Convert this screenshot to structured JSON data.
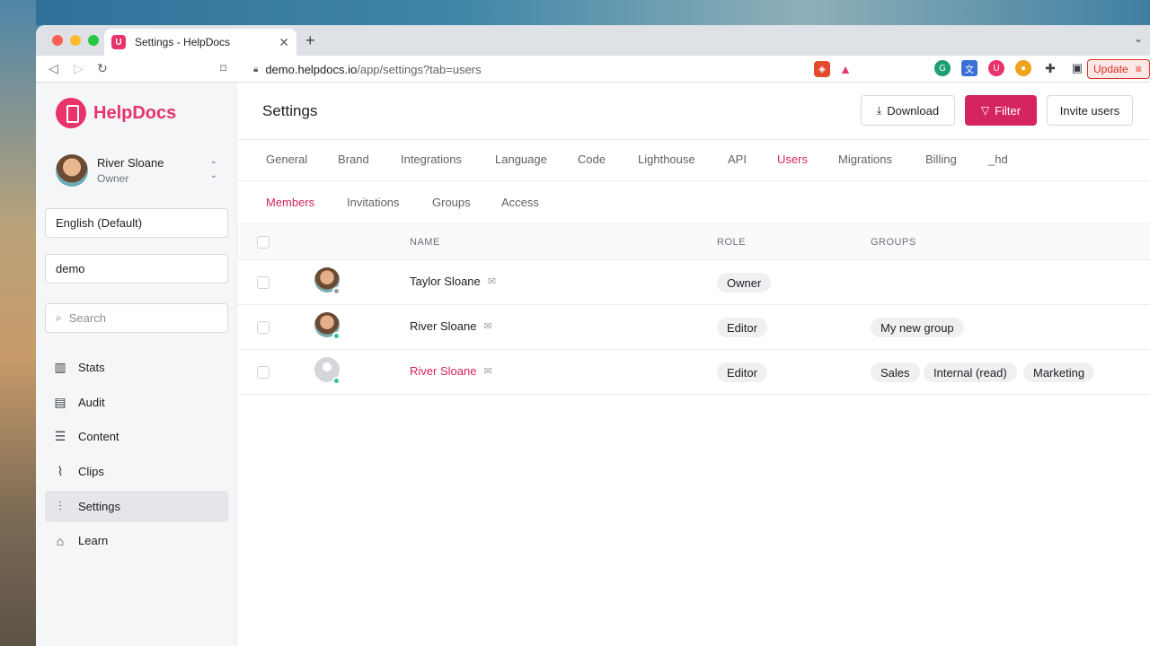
{
  "browser": {
    "tab_title": "Settings - HelpDocs",
    "url_host": "demo.helpdocs.io",
    "url_path": "/app/settings?tab=users",
    "update_label": "Update",
    "favicon_glyph": "U"
  },
  "brand": {
    "name": "HelpDocs",
    "accent": "#e8336b"
  },
  "sidebar": {
    "user_name": "River Sloane",
    "user_role": "Owner",
    "language_value": "English (Default)",
    "workspace_value": "demo",
    "search_placeholder": "Search",
    "items": [
      {
        "label": "Stats",
        "icon": "bar-chart-icon"
      },
      {
        "label": "Audit",
        "icon": "clipboard-icon"
      },
      {
        "label": "Content",
        "icon": "stack-icon"
      },
      {
        "label": "Clips",
        "icon": "paperclip-icon"
      },
      {
        "label": "Settings",
        "icon": "sliders-icon",
        "active": true
      },
      {
        "label": "Learn",
        "icon": "graduation-cap-icon"
      }
    ]
  },
  "header": {
    "title": "Settings",
    "download_label": "Download",
    "filter_label": "Filter",
    "invite_label": "Invite users"
  },
  "settings_tabs": [
    "General",
    "Brand",
    "Integrations",
    "Language",
    "Code",
    "Lighthouse",
    "API",
    "Users",
    "Migrations",
    "Billing",
    "_hd"
  ],
  "settings_tab_active": "Users",
  "user_tabs": [
    "Members",
    "Invitations",
    "Groups",
    "Access"
  ],
  "user_tab_active": "Members",
  "table": {
    "columns": {
      "name": "NAME",
      "role": "ROLE",
      "groups": "GROUPS"
    },
    "rows": [
      {
        "name": "Taylor Sloane",
        "role": "Owner",
        "groups": [],
        "status": "offline",
        "avatar": "photo"
      },
      {
        "name": "River Sloane",
        "role": "Editor",
        "groups": [
          "My new group"
        ],
        "status": "online",
        "avatar": "photo"
      },
      {
        "name": "River Sloane",
        "role": "Editor",
        "groups": [
          "Sales",
          "Internal (read)",
          "Marketing"
        ],
        "status": "online",
        "avatar": "blank",
        "highlight": true
      }
    ]
  }
}
